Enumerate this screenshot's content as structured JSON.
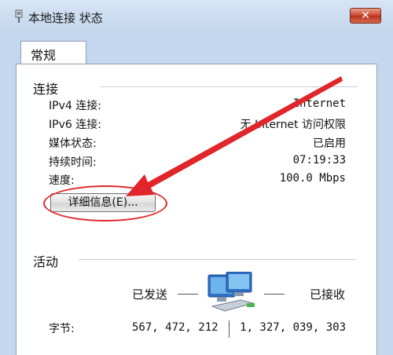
{
  "window": {
    "title": "本地连接 状态",
    "close_label": "✕"
  },
  "tabs": [
    {
      "label": "常规"
    }
  ],
  "connection": {
    "section_label": "连接",
    "rows": [
      {
        "label": "IPv4 连接:",
        "value": "Internet"
      },
      {
        "label": "IPv6 连接:",
        "value": "无 Internet 访问权限"
      },
      {
        "label": "媒体状态:",
        "value": "已启用"
      },
      {
        "label": "持续时间:",
        "value": "07:19:33"
      },
      {
        "label": "速度:",
        "value": "100.0 Mbps"
      }
    ],
    "details_button": "详细信息(E)..."
  },
  "activity": {
    "section_label": "活动",
    "sent_label": "已发送",
    "received_label": "已接收",
    "bytes_label": "字节:",
    "bytes_sent": "567, 472, 212",
    "bytes_received": "1, 327, 039, 303"
  },
  "annotation": {
    "color": "#e0262a"
  },
  "icons": {
    "window": "network-adapter-icon",
    "activity": "network-computers-icon"
  }
}
